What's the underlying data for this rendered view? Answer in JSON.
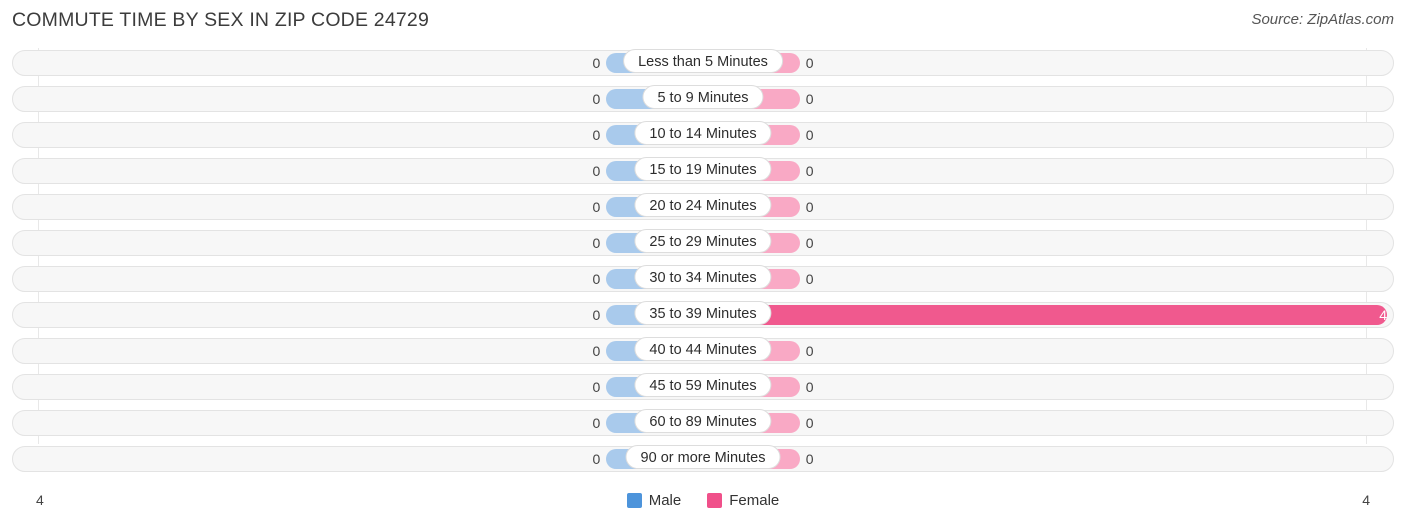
{
  "header": {
    "title": "COMMUTE TIME BY SEX IN ZIP CODE 24729",
    "source": "Source: ZipAtlas.com"
  },
  "legend": {
    "male": {
      "label": "Male",
      "color": "#4d94db"
    },
    "female": {
      "label": "Female",
      "color": "#f0508a"
    }
  },
  "axis": {
    "left_label": "4",
    "right_label": "4",
    "max": 4
  },
  "colors": {
    "male_bar": "#a9caec",
    "female_bar": "#f9a9c5",
    "female_bar_highlight": "#f0598e",
    "track": "#f7f7f7",
    "track_border": "#e3e3e3"
  },
  "chart_data": {
    "type": "bar",
    "orientation": "horizontal",
    "style": "diverging-bidirectional",
    "title": "COMMUTE TIME BY SEX IN ZIP CODE 24729",
    "xlabel": "",
    "ylabel": "",
    "xlim": [
      4,
      4
    ],
    "grid": true,
    "legend_position": "bottom-center",
    "categories": [
      "Less than 5 Minutes",
      "5 to 9 Minutes",
      "10 to 14 Minutes",
      "15 to 19 Minutes",
      "20 to 24 Minutes",
      "25 to 29 Minutes",
      "30 to 34 Minutes",
      "35 to 39 Minutes",
      "40 to 44 Minutes",
      "45 to 59 Minutes",
      "60 to 89 Minutes",
      "90 or more Minutes"
    ],
    "series": [
      {
        "name": "Male",
        "color": "#4d94db",
        "values": [
          0,
          0,
          0,
          0,
          0,
          0,
          0,
          0,
          0,
          0,
          0,
          0
        ]
      },
      {
        "name": "Female",
        "color": "#f0508a",
        "values": [
          0,
          0,
          0,
          0,
          0,
          0,
          0,
          4,
          0,
          0,
          0,
          0
        ]
      }
    ]
  },
  "rows": [
    {
      "label": "Less than 5 Minutes",
      "male": "0",
      "female": "0",
      "male_pct": 7.0,
      "female_pct": 7.0,
      "highlight": false
    },
    {
      "label": "5 to 9 Minutes",
      "male": "0",
      "female": "0",
      "male_pct": 7.0,
      "female_pct": 7.0,
      "highlight": false
    },
    {
      "label": "10 to 14 Minutes",
      "male": "0",
      "female": "0",
      "male_pct": 7.0,
      "female_pct": 7.0,
      "highlight": false
    },
    {
      "label": "15 to 19 Minutes",
      "male": "0",
      "female": "0",
      "male_pct": 7.0,
      "female_pct": 7.0,
      "highlight": false
    },
    {
      "label": "20 to 24 Minutes",
      "male": "0",
      "female": "0",
      "male_pct": 7.0,
      "female_pct": 7.0,
      "highlight": false
    },
    {
      "label": "25 to 29 Minutes",
      "male": "0",
      "female": "0",
      "male_pct": 7.0,
      "female_pct": 7.0,
      "highlight": false
    },
    {
      "label": "30 to 34 Minutes",
      "male": "0",
      "female": "0",
      "male_pct": 7.0,
      "female_pct": 7.0,
      "highlight": false
    },
    {
      "label": "35 to 39 Minutes",
      "male": "0",
      "female": "4",
      "male_pct": 7.0,
      "female_pct": 49.5,
      "highlight": true
    },
    {
      "label": "40 to 44 Minutes",
      "male": "0",
      "female": "0",
      "male_pct": 7.0,
      "female_pct": 7.0,
      "highlight": false
    },
    {
      "label": "45 to 59 Minutes",
      "male": "0",
      "female": "0",
      "male_pct": 7.0,
      "female_pct": 7.0,
      "highlight": false
    },
    {
      "label": "60 to 89 Minutes",
      "male": "0",
      "female": "0",
      "male_pct": 7.0,
      "female_pct": 7.0,
      "highlight": false
    },
    {
      "label": "90 or more Minutes",
      "male": "0",
      "female": "0",
      "male_pct": 7.0,
      "female_pct": 7.0,
      "highlight": false
    }
  ]
}
